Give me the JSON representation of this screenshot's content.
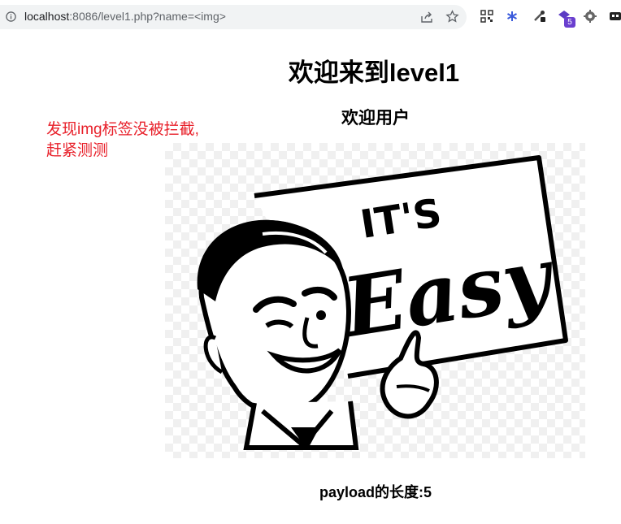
{
  "browser": {
    "url_host": "localhost",
    "url_rest": ":8086/level1.php?name=<img>",
    "badge_count": "5",
    "icons": [
      "info-icon",
      "share-icon",
      "star-icon",
      "qr-icon",
      "asterisk-extension-icon",
      "dropper-extension-icon",
      "puzzle-extension-icon",
      "gear-extension-icon",
      "camera-extension-icon"
    ]
  },
  "page": {
    "title": "欢迎来到level1",
    "welcome": "欢迎用户",
    "payload_text": "payload的长度:5"
  },
  "annotation": {
    "line1": "发现img标签没被拦截,",
    "line2": "赶紧测测",
    "color": "#e8202a"
  },
  "image": {
    "sign_top": "IT'S",
    "sign_main": "Easy"
  }
}
